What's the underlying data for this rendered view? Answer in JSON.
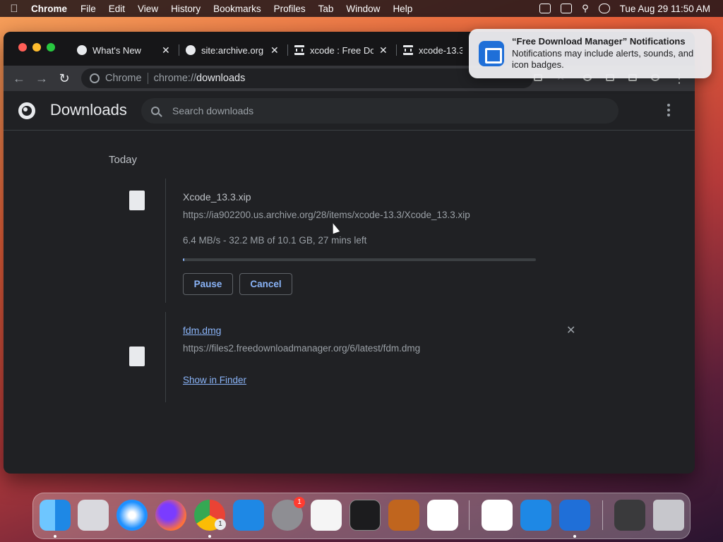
{
  "menubar": {
    "app_name": "Chrome",
    "menus": [
      "File",
      "Edit",
      "View",
      "History",
      "Bookmarks",
      "Profiles",
      "Tab",
      "Window",
      "Help"
    ],
    "clock": "Tue Aug 29  11:50 AM"
  },
  "tabs": [
    {
      "title": "What's New"
    },
    {
      "title": "site:archive.org"
    },
    {
      "title": "xcode : Free Do"
    },
    {
      "title": "xcode-13.3 d"
    }
  ],
  "omnibox": {
    "chip": "Chrome",
    "scheme": "chrome://",
    "host": "downloads"
  },
  "downloads_page": {
    "title": "Downloads",
    "search_placeholder": "Search downloads",
    "date_heading": "Today",
    "items": [
      {
        "filename": "Xcode_13.3.xip",
        "url": "https://ia902200.us.archive.org/28/items/xcode-13.3/Xcode_13.3.xip",
        "status": "6.4 MB/s - 32.2 MB of 10.1 GB, 27 mins left",
        "progress_fraction": 0.003,
        "pause_label": "Pause",
        "cancel_label": "Cancel"
      },
      {
        "filename": "fdm.dmg",
        "url": "https://files2.freedownloadmanager.org/6/latest/fdm.dmg",
        "show_in_finder_label": "Show in Finder"
      }
    ]
  },
  "notification": {
    "title": "“Free Download Manager” Notifications",
    "body": "Notifications may include alerts, sounds, and icon badges."
  },
  "dock": {
    "apps": [
      "Finder",
      "Launchpad",
      "Safari",
      "Firefox",
      "Chrome",
      "App Store",
      "System Settings",
      "TextEdit",
      "Terminal",
      "GarageBand",
      "Visual Studio Code",
      "Visual Studio",
      "iCloud",
      "Free Download Manager",
      "Downloads",
      "Trash"
    ],
    "badges": {
      "chrome": "1",
      "system_settings": "1"
    }
  },
  "colors": {
    "accent": "#8ab4f8",
    "page_bg": "#202124",
    "toolbar_bg": "#35363a"
  }
}
